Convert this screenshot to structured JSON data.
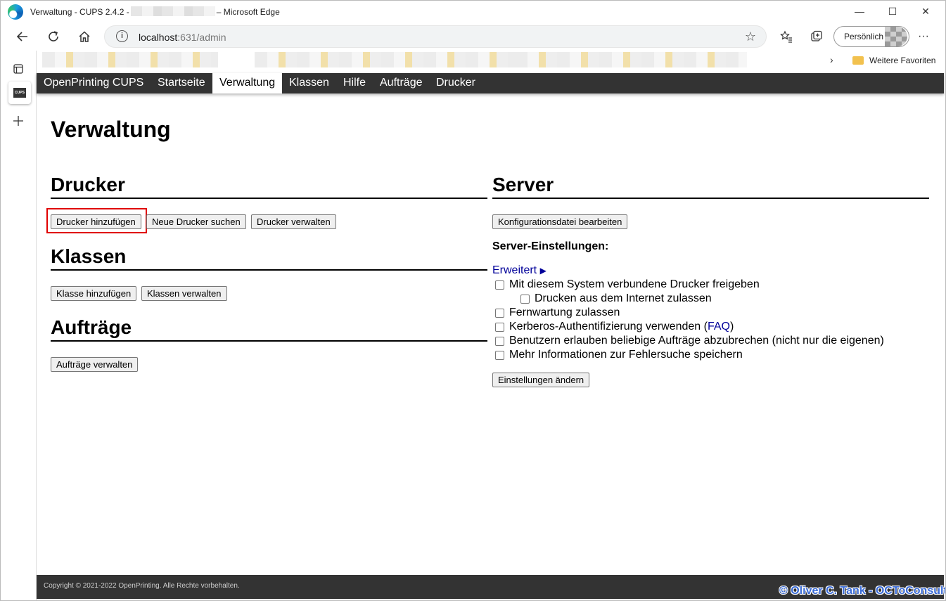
{
  "window": {
    "title_prefix": "Verwaltung - CUPS 2.4.2 -",
    "title_suffix": "– Microsoft Edge",
    "minimize_icon": "minimize-icon",
    "maximize_icon": "maximize-icon",
    "close_icon": "close-icon"
  },
  "address_bar": {
    "host": "localhost",
    "path": ":631/admin"
  },
  "profile": {
    "label": "Persönlich"
  },
  "favorites": {
    "folder_label": "Weitere Favoriten"
  },
  "nav": {
    "items": [
      {
        "label": "OpenPrinting CUPS"
      },
      {
        "label": "Startseite"
      },
      {
        "label": "Verwaltung"
      },
      {
        "label": "Klassen"
      },
      {
        "label": "Hilfe"
      },
      {
        "label": "Aufträge"
      },
      {
        "label": "Drucker"
      }
    ]
  },
  "page": {
    "title": "Verwaltung"
  },
  "printers": {
    "heading": "Drucker",
    "add": "Drucker hinzufügen",
    "find": "Neue Drucker suchen",
    "manage": "Drucker verwalten"
  },
  "classes": {
    "heading": "Klassen",
    "add": "Klasse hinzufügen",
    "manage": "Klassen verwalten"
  },
  "jobs": {
    "heading": "Aufträge",
    "manage": "Aufträge verwalten"
  },
  "server": {
    "heading": "Server",
    "edit_config": "Konfigurationsdatei bearbeiten",
    "settings_label": "Server-Einstellungen:",
    "advanced_link": "Erweitert",
    "advanced_arrow": "▶",
    "options": {
      "share": "Mit diesem System verbundene Drucker freigeben",
      "internet": "Drucken aus dem Internet zulassen",
      "remote_admin": "Fernwartung zulassen",
      "kerberos_pre": "Kerberos-Authentifizierung verwenden (",
      "kerberos_faq": "FAQ",
      "kerberos_post": ")",
      "cancel_any": "Benutzern erlauben beliebige Aufträge abzubrechen (nicht nur die eigenen)",
      "debug": "Mehr Informationen zur Fehlersuche speichern"
    },
    "change_settings": "Einstellungen ändern"
  },
  "footer": {
    "text": "Copyright © 2021-2022 OpenPrinting. Alle Rechte vorbehalten."
  },
  "watermark": "© Oliver C. Tank - OCToConsult"
}
